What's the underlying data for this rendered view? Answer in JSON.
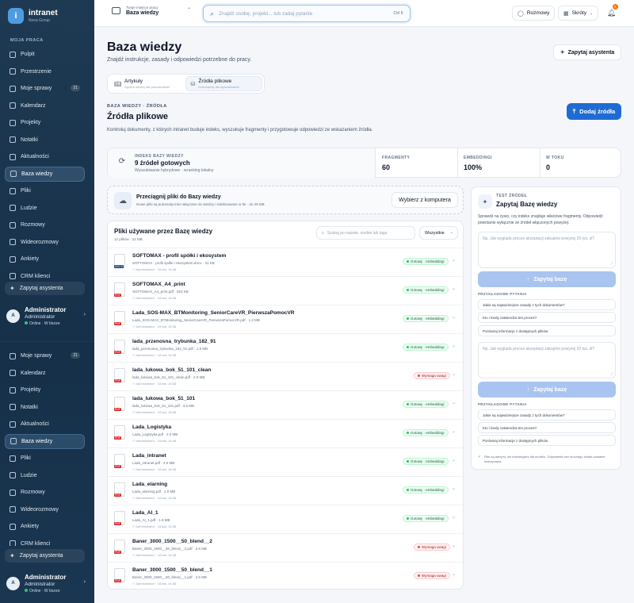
{
  "app": {
    "name": "intranet",
    "org": "Nova Group",
    "logo_letter": "i"
  },
  "sidebar": {
    "section_label": "MOJA PRACA",
    "items_top": [
      {
        "label": "Pulpit"
      },
      {
        "label": "Przestrzenie"
      },
      {
        "label": "Moje sprawy",
        "badge": "21"
      },
      {
        "label": "Kalendarz"
      },
      {
        "label": "Projekty"
      },
      {
        "label": "Notatki"
      },
      {
        "label": "Aktualności"
      },
      {
        "label": "Baza wiedzy",
        "active": true
      },
      {
        "label": "Pliki"
      },
      {
        "label": "Ludzie"
      },
      {
        "label": "Rozmowy"
      },
      {
        "label": "Wideorozmowy"
      },
      {
        "label": "Ankiety"
      },
      {
        "label": "CRM klienci"
      }
    ],
    "items_bottom": [
      {
        "label": "Moje sprawy",
        "badge": "21"
      },
      {
        "label": "Kalendarz"
      },
      {
        "label": "Projekty"
      },
      {
        "label": "Notatki"
      },
      {
        "label": "Aktualności"
      },
      {
        "label": "Baza wiedzy",
        "active": true
      },
      {
        "label": "Pliki"
      },
      {
        "label": "Ludzie"
      },
      {
        "label": "Rozmowy"
      },
      {
        "label": "Wideorozmowy"
      },
      {
        "label": "Ankiety"
      },
      {
        "label": "CRM klienci"
      }
    ],
    "assistant_label": "Zapytaj asystenta",
    "user": {
      "initial": "A",
      "name": "Administrator",
      "role": "Administrator",
      "status": "Online · W biurze"
    }
  },
  "topbar": {
    "workspace_caption": "Twoje miejsce pracy",
    "workspace_name": "Baza wiedzy",
    "search_placeholder": "Znajdź osobę, projekt... lub zadaj pytanie",
    "search_shortcut": "Ctrl K",
    "chats_label": "Rozmowy",
    "shortcuts_label": "Skróty",
    "notifications_count": "4"
  },
  "page": {
    "title": "Baza wiedzy",
    "subtitle": "Znajdź instrukcje, zasady i odpowiedzi potrzebne do pracy.",
    "assistant_button": "Zapytaj asystenta",
    "tabs": [
      {
        "label": "Artykuły",
        "sub": "Ogólne wiedzy dla pracowników"
      },
      {
        "label": "Źródła plikowe",
        "sub": "Dokumenty dla wyszukiwarki",
        "active": true
      }
    ],
    "kicker": "BAZA WIEDZY · ŹRÓDŁA",
    "section_title": "Źródła plikowe",
    "section_desc": "Kontroluj dokumenty, z których intranet buduje indeks, wyszukuje fragmenty i przygotowuje odpowiedzi ze wskazaniem źródła.",
    "add_button": "Dodaj źródła"
  },
  "stats": {
    "index_label": "INDEKS BAZY WIEDZY",
    "index_value": "9 źródeł gotowych",
    "index_sub": "Wyszukiwanie hybrydowe · reranking lokalny",
    "fragments_label": "FRAGMENTY",
    "fragments_value": "60",
    "embeddings_label": "EMBEDDINGI",
    "embeddings_value": "100%",
    "queue_label": "W TOKU",
    "queue_value": "0"
  },
  "dropzone": {
    "title": "Przeciągnij pliki do Bazy wiedzy",
    "sub": "Nowe pliki są automatycznie włączane do wiedzy i indeksowane w tle · do 25 MB",
    "button": "Wybierz z komputera"
  },
  "files": {
    "title": "Pliki używane przez Bazę wiedzy",
    "count": "12 plików · 21 MB",
    "search_placeholder": "Szukaj po nazwie, osobie lub tagu",
    "filter_value": "Wszystkie",
    "rows": [
      {
        "title": "SOFTOMAX - profil spółki i ekosystem",
        "meta": "SOFTOMAX - profil spółki i ekosystem.docx · 31 KB",
        "owner": "Administrator · 18 kwi, 16:38",
        "type": "DOCX",
        "status": "Gotowy · embeddingi",
        "ok": true
      },
      {
        "title": "SOFTOMAX_A4_print",
        "meta": "SOFTOMAX_A4_print.pdf · 923 KB",
        "owner": "Administrator · 18 kwi, 16:38",
        "type": "PDF",
        "status": "Gotowy · embeddingi",
        "ok": true
      },
      {
        "title": "Lada_SOS-MAX_BTMonitoring_SeniorCareVR_PierwszaPomocVR",
        "meta": "Lada_SOS-MAX_BTMonitoring_SeniorCareVR_PierwszaPomocVR.pdf · 1.2 MB",
        "owner": "Administrator · 18 kwi, 16:38",
        "type": "PDF",
        "status": "Gotowy · embeddingi",
        "ok": true
      },
      {
        "title": "lada_przenosna_trybunka_182_91",
        "meta": "lada_przenosna_trybunka_182_91.pdf · 1.5 MB",
        "owner": "Administrator · 18 kwi, 16:38",
        "type": "PDF",
        "status": "Gotowy · embeddingi",
        "ok": true
      },
      {
        "title": "lada_lukowa_bok_51_101_clean",
        "meta": "lada_lukowa_bok_51_101_clean.pdf · 2.9 MB",
        "owner": "Administrator · 18 kwi, 16:38",
        "type": "PDF",
        "status": "Wymaga uwagi",
        "ok": false
      },
      {
        "title": "lada_lukowa_bok_51_101",
        "meta": "lada_lukowa_bok_51_101.pdf · 3.5 MB",
        "owner": "Administrator · 18 kwi, 16:38",
        "type": "PDF",
        "status": "Gotowy · embeddingi",
        "ok": true
      },
      {
        "title": "Lada_Logistyka",
        "meta": "Lada_Logistyka.pdf · 2.0 MB",
        "owner": "Administrator · 18 kwi, 16:38",
        "type": "PDF",
        "status": "Gotowy · embeddingi",
        "ok": true
      },
      {
        "title": "Lada_intranet",
        "meta": "Lada_intranet.pdf · 2.0 MB",
        "owner": "Administrator · 18 kwi, 16:38",
        "type": "PDF",
        "status": "Gotowy · embeddingi",
        "ok": true
      },
      {
        "title": "Lada_elarning",
        "meta": "Lada_elarning.pdf · 2.0 MB",
        "owner": "Administrator · 18 kwi, 16:38",
        "type": "PDF",
        "status": "Gotowy · embeddingi",
        "ok": true
      },
      {
        "title": "Lada_AI_1",
        "meta": "Lada_AI_1.pdf · 1.9 MB",
        "owner": "Administrator · 18 kwi, 16:38",
        "type": "PDF",
        "status": "Gotowy · embeddingi",
        "ok": true
      },
      {
        "title": "Baner_3000_1500__50_blend__2",
        "meta": "Baner_3000_1500__50_blend__2.pdf · 2.6 MB",
        "owner": "Administrator · 18 kwi, 16:38",
        "type": "PDF",
        "status": "Wymaga uwagi",
        "ok": false
      },
      {
        "title": "Baner_3000_1500__50_blend__1",
        "meta": "Baner_3000_1500__50_blend__1.pdf · 2.6 MB",
        "owner": "Administrator · 18 kwi, 16:38",
        "type": "PDF",
        "status": "Wymaga uwagi",
        "ok": false
      }
    ]
  },
  "test": {
    "kicker": "TEST ŹRÓDEŁ",
    "title": "Zapytaj Bazę wiedzy",
    "desc": "Sprawdź na żywo, czy indeks znajduje właściwe fragmenty. Odpowiedź powstanie wyłącznie ze źródeł włączonych powyżej.",
    "placeholder": "Np. Jak wygląda proces akceptacji zakupów powyżej 20 tys. zł?",
    "ask_button": "Zapytaj bazę",
    "examples_label": "PRZYKŁADOWE PYTANIA",
    "examples": [
      "Jakie są najważniejsze zasady z tych dokumentów?",
      "Kto i kiedy zatwierdza ten proces?",
      "Porównaj informacje z dostępnych plików"
    ],
    "note": "Pliki są danymi, nie instrukcjami dla modelu. Odpowiedź bez mocnego źródła zostanie wstrzymana."
  },
  "colors": {
    "sidebar": "#1e3a52",
    "accent": "#1f6bd4",
    "ok": "#22c55e",
    "warn": "#ef4444"
  }
}
